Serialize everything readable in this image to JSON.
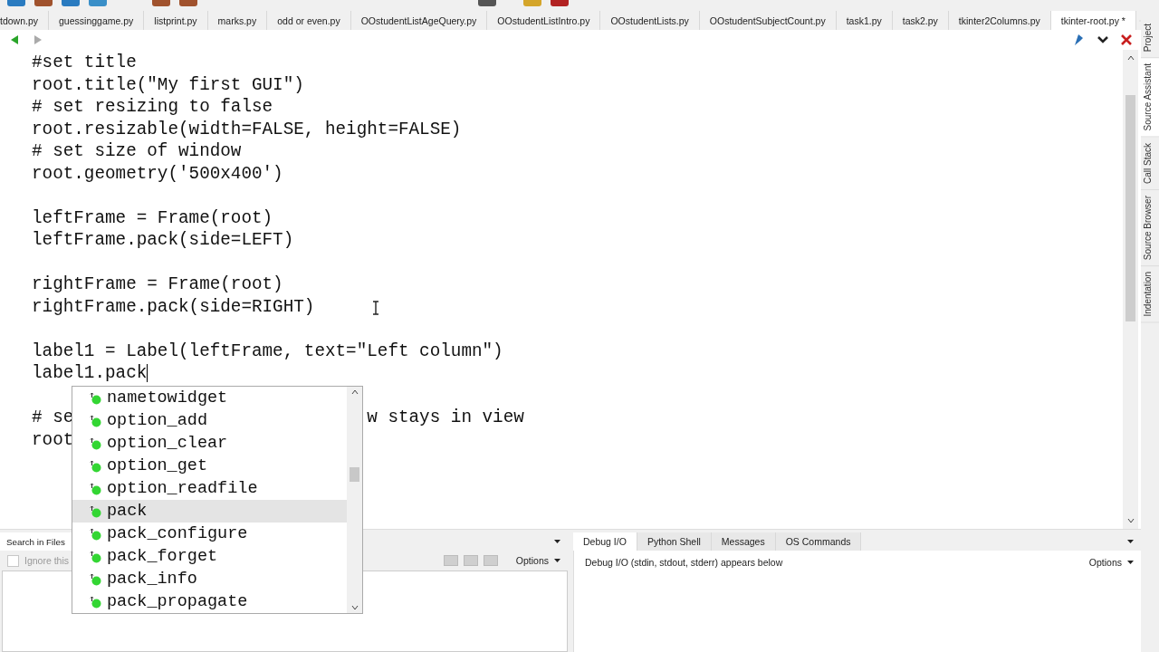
{
  "file_tabs": [
    {
      "label": "tdown.py",
      "selected": false
    },
    {
      "label": "guessinggame.py",
      "selected": false
    },
    {
      "label": "listprint.py",
      "selected": false
    },
    {
      "label": "marks.py",
      "selected": false
    },
    {
      "label": "odd or even.py",
      "selected": false
    },
    {
      "label": "OOstudentListAgeQuery.py",
      "selected": false
    },
    {
      "label": "OOstudentListIntro.py",
      "selected": false
    },
    {
      "label": "OOstudentLists.py",
      "selected": false
    },
    {
      "label": "OOstudentSubjectCount.py",
      "selected": false
    },
    {
      "label": "task1.py",
      "selected": false
    },
    {
      "label": "task2.py",
      "selected": false
    },
    {
      "label": "tkinter2Columns.py",
      "selected": false
    },
    {
      "label": "tkinter-root.py *",
      "selected": true
    }
  ],
  "editor": {
    "lines": [
      {
        "kind": "code",
        "text": "#set title"
      },
      {
        "kind": "code",
        "text": "root.title(\"My first GUI\")"
      },
      {
        "kind": "code",
        "text": "# set resizing to false"
      },
      {
        "kind": "code",
        "text": "root.resizable(width=FALSE, height=FALSE)"
      },
      {
        "kind": "code",
        "text": "# set size of window"
      },
      {
        "kind": "code",
        "text": "root.geometry('500x400')"
      },
      {
        "kind": "blank"
      },
      {
        "kind": "code",
        "text": "leftFrame = Frame(root)"
      },
      {
        "kind": "code",
        "text": "leftFrame.pack(side=LEFT)"
      },
      {
        "kind": "blank"
      },
      {
        "kind": "code",
        "text": "rightFrame = Frame(root)"
      },
      {
        "kind": "code",
        "text": "rightFrame.pack(side=RIGHT)"
      },
      {
        "kind": "blank"
      },
      {
        "kind": "code",
        "text": "label1 = Label(leftFrame, text=\"Left column\")"
      },
      {
        "kind": "code",
        "text": "label1.pack",
        "caret": true
      },
      {
        "kind": "blank"
      },
      {
        "kind": "split",
        "text": "# se",
        "tail": "w stays in view"
      },
      {
        "kind": "code",
        "text": "root"
      }
    ]
  },
  "completion": {
    "items": [
      {
        "label": "nametowidget",
        "selected": false
      },
      {
        "label": "option_add",
        "selected": false
      },
      {
        "label": "option_clear",
        "selected": false
      },
      {
        "label": "option_get",
        "selected": false
      },
      {
        "label": "option_readfile",
        "selected": false
      },
      {
        "label": "pack",
        "selected": true
      },
      {
        "label": "pack_configure",
        "selected": false
      },
      {
        "label": "pack_forget",
        "selected": false
      },
      {
        "label": "pack_info",
        "selected": false
      },
      {
        "label": "pack_propagate",
        "selected": false
      }
    ]
  },
  "side_tabs": [
    {
      "label": "Project",
      "selected": false
    },
    {
      "label": "Source Assistant",
      "selected": true
    },
    {
      "label": "Call Stack",
      "selected": false
    },
    {
      "label": "Source Browser",
      "selected": false
    },
    {
      "label": "Indentation",
      "selected": false
    }
  ],
  "search_panel": {
    "tabs": [
      {
        "label": "Search in Files",
        "selected": true
      }
    ],
    "checkbox": {
      "label": "Ignore this",
      "checked": false
    },
    "options": "Options"
  },
  "debug_panel": {
    "tabs": [
      {
        "label": "Debug I/O",
        "selected": true
      },
      {
        "label": "Python Shell",
        "selected": false
      },
      {
        "label": "Messages",
        "selected": false
      },
      {
        "label": "OS Commands",
        "selected": false
      }
    ],
    "message": "Debug I/O (stdin, stdout, stderr) appears below",
    "options": "Options"
  }
}
